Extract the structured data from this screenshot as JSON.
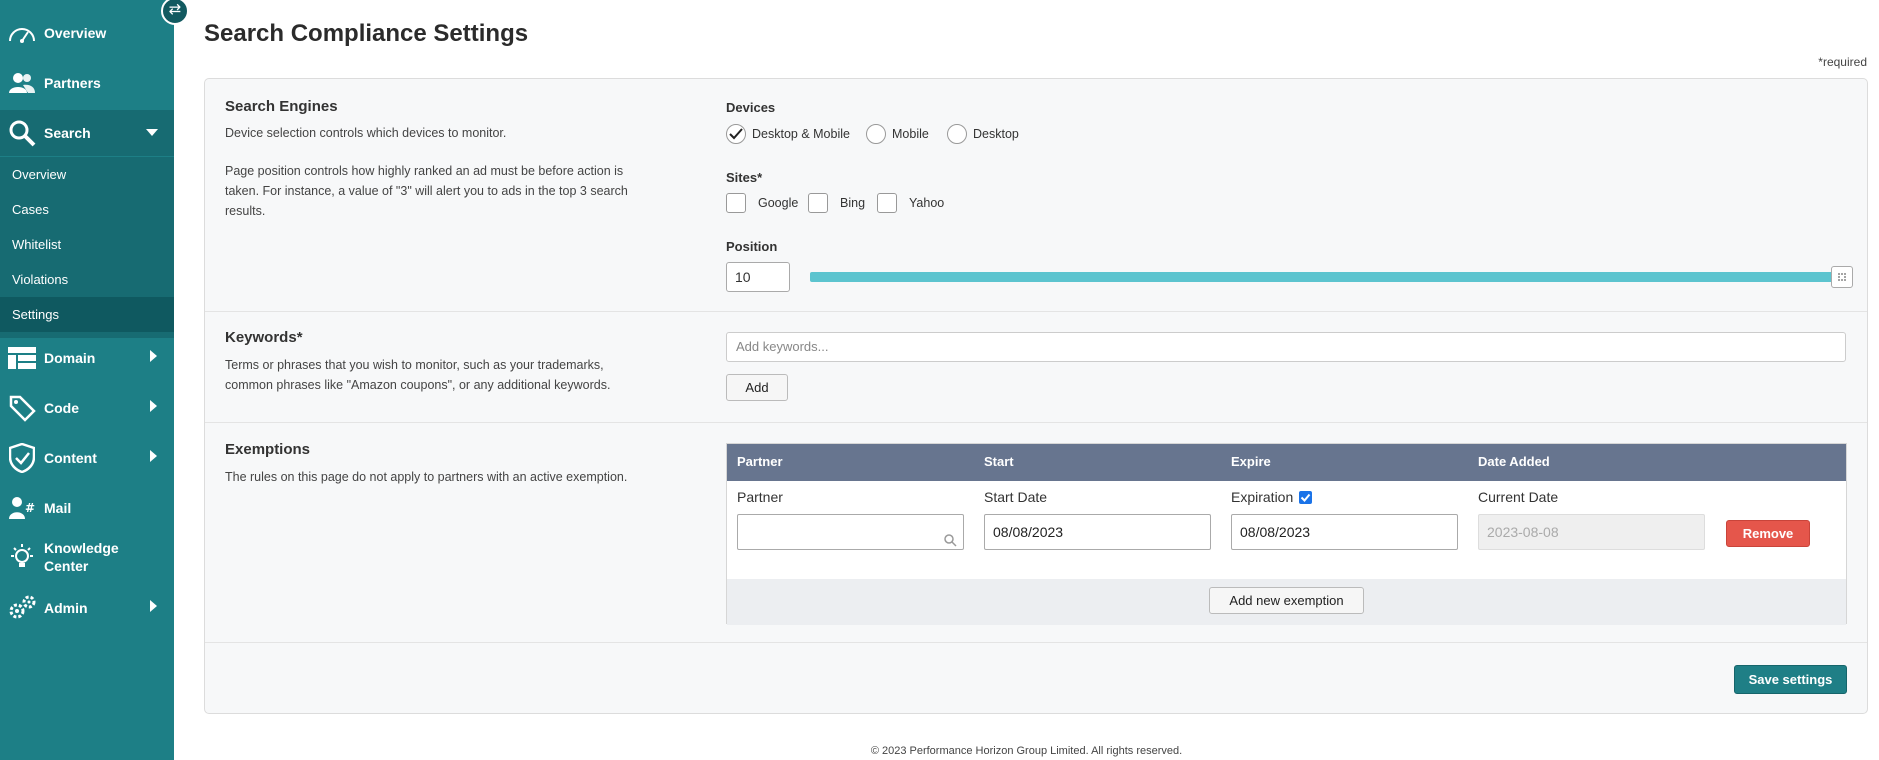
{
  "sidebar": {
    "nav": {
      "overview": "Overview",
      "partners": "Partners",
      "search": "Search",
      "domain": "Domain",
      "code": "Code",
      "content": "Content",
      "mail": "Mail",
      "knowledge_line1": "Knowledge",
      "knowledge_line2": "Center",
      "admin": "Admin"
    },
    "search_sub": [
      "Overview",
      "Cases",
      "Whitelist",
      "Violations",
      "Settings"
    ],
    "active_sub": "Settings"
  },
  "page": {
    "title": "Search Compliance Settings",
    "required_note": "*required"
  },
  "search_engines": {
    "title": "Search Engines",
    "desc1": "Device selection controls which devices to monitor.",
    "desc2": "Page position controls how highly ranked an ad must be before action is taken. For instance, a value of \"3\" will alert you to ads in the top 3 search results.",
    "devices_label": "Devices",
    "devices": [
      "Desktop & Mobile",
      "Mobile",
      "Desktop"
    ],
    "selected_device": "Desktop & Mobile",
    "sites_label": "Sites*",
    "sites": [
      "Google",
      "Bing",
      "Yahoo"
    ],
    "position_label": "Position",
    "position_value": "10",
    "position_slider_fraction": 1.0
  },
  "keywords": {
    "title": "Keywords*",
    "desc": "Terms or phrases that you wish to monitor, such as your trademarks, common phrases like \"Amazon coupons\", or any additional keywords.",
    "placeholder": "Add keywords...",
    "add_label": "Add"
  },
  "exemptions": {
    "title": "Exemptions",
    "desc": "The rules on this page do not apply to partners with an active exemption.",
    "columns": [
      "Partner",
      "Start",
      "Expire",
      "Date Added"
    ],
    "row": {
      "partner_label": "Partner",
      "partner_value": "",
      "start_label": "Start Date",
      "start_value": "08/08/2023",
      "expire_label": "Expiration",
      "expire_checked": true,
      "expire_value": "08/08/2023",
      "date_added_label": "Current Date",
      "date_added_value": "2023-08-08",
      "remove_label": "Remove"
    },
    "add_label": "Add new exemption"
  },
  "save_label": "Save settings",
  "footer": "© 2023 Performance Horizon Group Limited. All rights reserved.",
  "colors": {
    "sidebar": "#1d7f86",
    "slider": "#5cc4cf",
    "table_header": "#67758f",
    "remove": "#e5564b",
    "save": "#1f7f86"
  }
}
